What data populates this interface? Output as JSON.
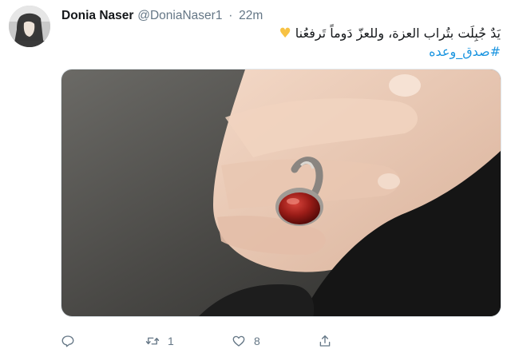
{
  "tweet": {
    "author_name": "Donia Naser",
    "author_handle": "@DoniaNaser1",
    "separator": "·",
    "time": "22m",
    "text_line1": "يَدٌ جُبِلَت بتُراب العزة، وللعزّ دَوماً تَرفعُنا",
    "emoji": "♥",
    "hashtag": "#صدق_وعده"
  },
  "actions": {
    "reply_count": "",
    "retweet_count": "1",
    "like_count": "8"
  },
  "icons": {
    "reply": "reply-icon",
    "retweet": "retweet-icon",
    "like": "heart-icon",
    "share": "share-icon",
    "emoji": "yellow-heart-icon"
  },
  "colors": {
    "link": "#1b95e0",
    "muted": "#657786",
    "heart": "#f7c244"
  }
}
